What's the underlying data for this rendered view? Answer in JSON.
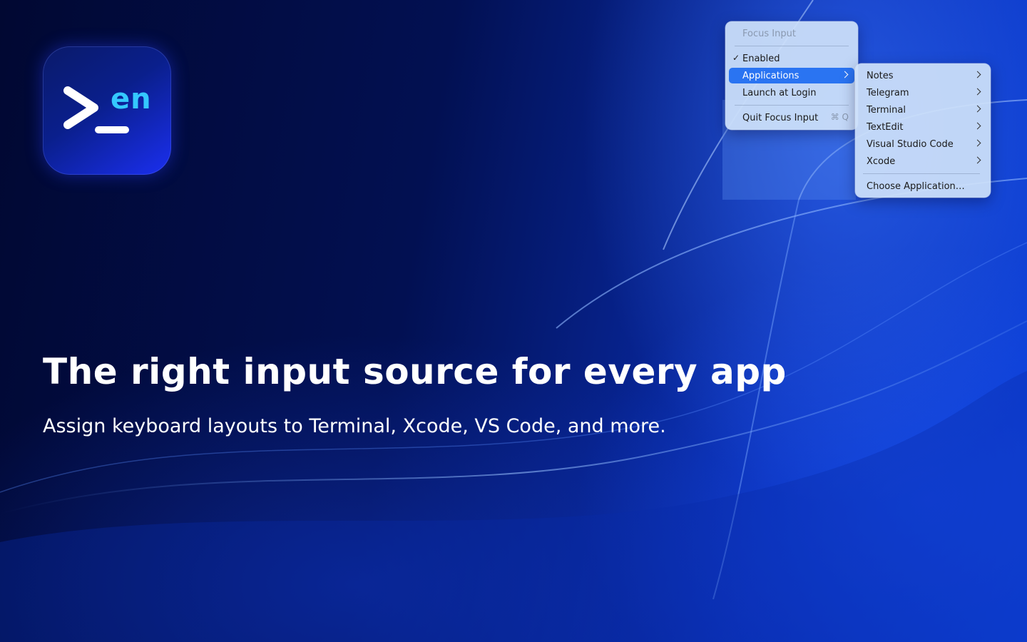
{
  "colors": {
    "background": "#010a3a",
    "accent_blue": "#2a74f2",
    "icon_en": "#34c8ff",
    "menu_bg": "#cde1fa"
  },
  "app_icon": {
    "icon": "terminal-prompt-icon",
    "text": "en"
  },
  "headline": "The right input source for every app",
  "subline": "Assign keyboard layouts to Terminal, Xcode, VS Code, and more.",
  "menu": {
    "title": "Focus Input",
    "items": [
      {
        "label": "Enabled",
        "checked": true
      },
      {
        "label": "Applications",
        "has_submenu": true,
        "selected": true
      },
      {
        "label": "Launch at Login"
      },
      {
        "label": "Quit Focus Input",
        "shortcut": "⌘ Q"
      }
    ]
  },
  "submenu": {
    "items": [
      {
        "label": "Notes",
        "has_submenu": true
      },
      {
        "label": "Telegram",
        "has_submenu": true
      },
      {
        "label": "Terminal",
        "has_submenu": true
      },
      {
        "label": "TextEdit",
        "has_submenu": true
      },
      {
        "label": "Visual Studio Code",
        "has_submenu": true
      },
      {
        "label": "Xcode",
        "has_submenu": true
      }
    ],
    "footer": "Choose Application…"
  }
}
